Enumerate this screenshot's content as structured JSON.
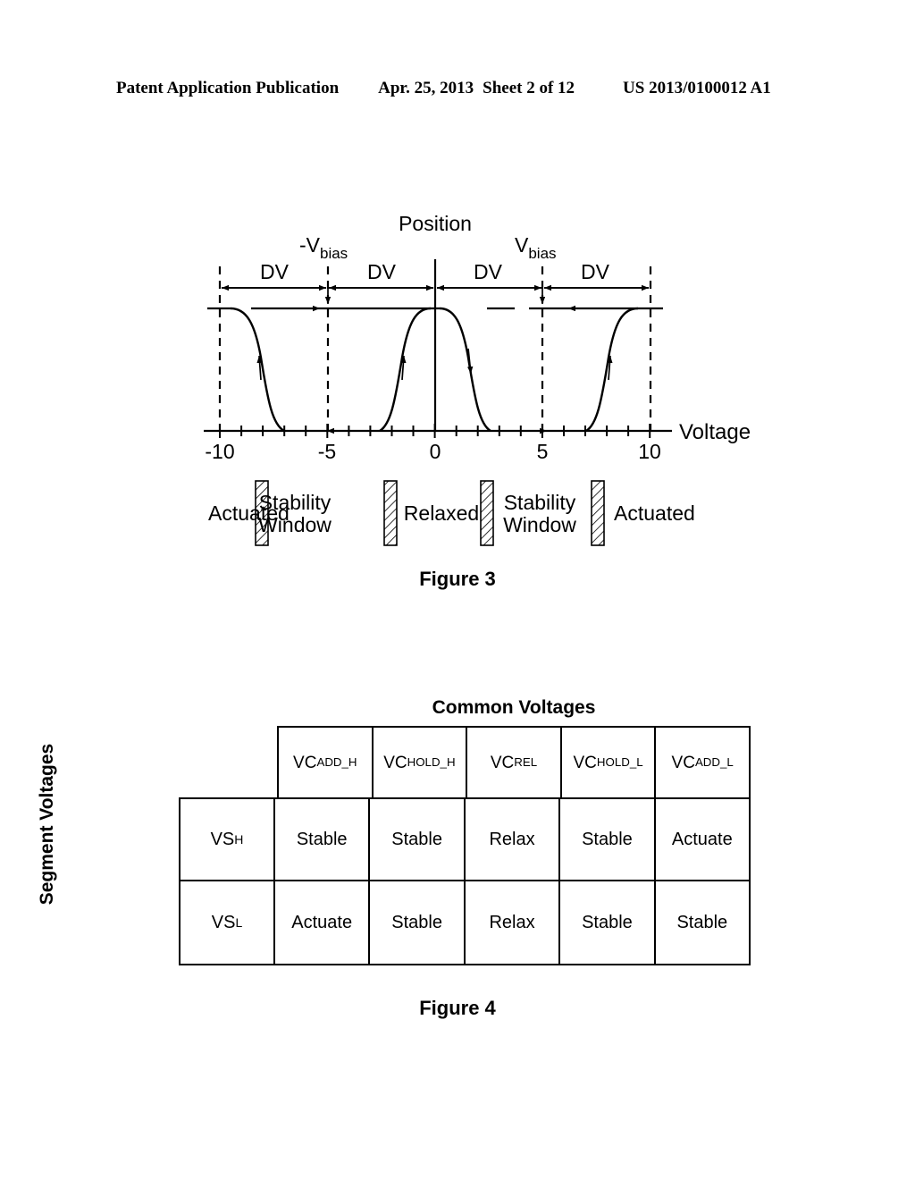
{
  "header": {
    "publication": "Patent Application Publication",
    "date": "Apr. 25, 2013",
    "sheet": "Sheet 2 of 12",
    "number": "US 2013/0100012 A1"
  },
  "figure3": {
    "caption": "Figure 3",
    "chart_data": {
      "type": "line",
      "title": "",
      "xlabel": "Voltage",
      "ylabel": "Position",
      "xlim": [
        -11.5,
        11.5
      ],
      "ylim": [
        0,
        1
      ],
      "xticks": [
        -10,
        -9,
        -8,
        -7,
        -6,
        -5,
        -4,
        -3,
        -2,
        -1,
        0,
        1,
        2,
        3,
        4,
        5,
        6,
        7,
        8,
        9,
        10
      ],
      "xticklabels": [
        {
          "x": -10,
          "label": "-10"
        },
        {
          "x": -5,
          "label": "-5"
        },
        {
          "x": 0,
          "label": "0"
        },
        {
          "x": 5,
          "label": "5"
        },
        {
          "x": 10,
          "label": "10"
        }
      ],
      "grid": false,
      "legend": "none",
      "series": [
        {
          "name": "negative-branch-falling",
          "description": "Upper branch falls from high position to low position near -8",
          "points": [
            [
              -11.5,
              1
            ],
            [
              -10,
              1
            ],
            [
              -9.2,
              0.98
            ],
            [
              -8.6,
              0.88
            ],
            [
              -8.2,
              0.62
            ],
            [
              -7.9,
              0.3
            ],
            [
              -7.5,
              0.09
            ],
            [
              -7.0,
              0.02
            ],
            [
              -6.6,
              0
            ]
          ]
        },
        {
          "name": "negative-branch-rising",
          "description": "Upper branch falls from high position to low position near -2.5",
          "points": [
            [
              -5.8,
              1
            ],
            [
              -4.2,
              1
            ],
            [
              -3.6,
              0.97
            ],
            [
              -3.1,
              0.85
            ],
            [
              -2.7,
              0.55
            ],
            [
              -2.4,
              0.22
            ],
            [
              -2.1,
              0.06
            ],
            [
              -1.9,
              0
            ]
          ]
        },
        {
          "name": "positive-branch-rising",
          "description": "Lower branch rises to high position near 2.5",
          "points": [
            [
              1.9,
              0
            ],
            [
              2.1,
              0.06
            ],
            [
              2.4,
              0.22
            ],
            [
              2.7,
              0.55
            ],
            [
              3.1,
              0.85
            ],
            [
              3.6,
              0.97
            ],
            [
              4.2,
              1
            ],
            [
              5.8,
              1
            ]
          ]
        },
        {
          "name": "positive-branch-falling",
          "description": "Lower branch rises to high position near 8",
          "points": [
            [
              6.6,
              0
            ],
            [
              7.0,
              0.02
            ],
            [
              7.5,
              0.09
            ],
            [
              7.9,
              0.3
            ],
            [
              8.2,
              0.62
            ],
            [
              8.6,
              0.88
            ],
            [
              9.2,
              0.98
            ],
            [
              10,
              1
            ],
            [
              11.5,
              1
            ]
          ]
        }
      ],
      "annotations": [
        {
          "label": "Position",
          "type": "axis-title",
          "x": 0
        },
        {
          "label": "Voltage",
          "type": "axis-title",
          "x": 11.5
        },
        {
          "label": "-Vbias",
          "type": "dashed-line-label",
          "x": -5
        },
        {
          "label": "Vbias",
          "type": "dashed-line-label",
          "x": 5
        },
        {
          "label": "DV",
          "type": "dimension",
          "from": -10,
          "to": -5
        },
        {
          "label": "DV",
          "type": "dimension",
          "from": -5,
          "to": 0
        },
        {
          "label": "DV",
          "type": "dimension",
          "from": 0,
          "to": 5
        },
        {
          "label": "DV",
          "type": "dimension",
          "from": 5,
          "to": 10
        }
      ],
      "dashed_lines": [
        -10,
        -5,
        5,
        10
      ],
      "solid_vertical_axis": 0,
      "region_labels": [
        "Actuated",
        "Stability Window",
        "Relaxed",
        "Stability Window",
        "Actuated"
      ],
      "region_dividers": [
        -7,
        -2,
        2,
        7
      ]
    },
    "vbias_neg_main": "-V",
    "vbias_neg_sub": "bias",
    "vbias_pos_main": "V",
    "vbias_pos_sub": "bias",
    "position_label": "Position",
    "voltage_label": "Voltage",
    "dv_label": "DV",
    "regions": [
      {
        "label_line1": "Actuated",
        "label_line2": ""
      },
      {
        "label_line1": "Stability",
        "label_line2": "Window"
      },
      {
        "label_line1": "Relaxed",
        "label_line2": ""
      },
      {
        "label_line1": "Stability",
        "label_line2": "Window"
      },
      {
        "label_line1": "Actuated",
        "label_line2": ""
      }
    ]
  },
  "figure4": {
    "caption": "Figure 4",
    "common_voltages_title": "Common Voltages",
    "segment_voltages_title": "Segment Voltages",
    "columns": [
      {
        "main": "VC",
        "sub": "ADD_H"
      },
      {
        "main": "VC",
        "sub": "HOLD_H"
      },
      {
        "main": "VC",
        "sub": "REL"
      },
      {
        "main": "VC",
        "sub": "HOLD_L"
      },
      {
        "main": "VC",
        "sub": "ADD_L"
      }
    ],
    "rows": [
      {
        "header_main": "VS",
        "header_sub": "H",
        "cells": [
          "Stable",
          "Stable",
          "Relax",
          "Stable",
          "Actuate"
        ]
      },
      {
        "header_main": "VS",
        "header_sub": "L",
        "cells": [
          "Actuate",
          "Stable",
          "Relax",
          "Stable",
          "Stable"
        ]
      }
    ]
  }
}
